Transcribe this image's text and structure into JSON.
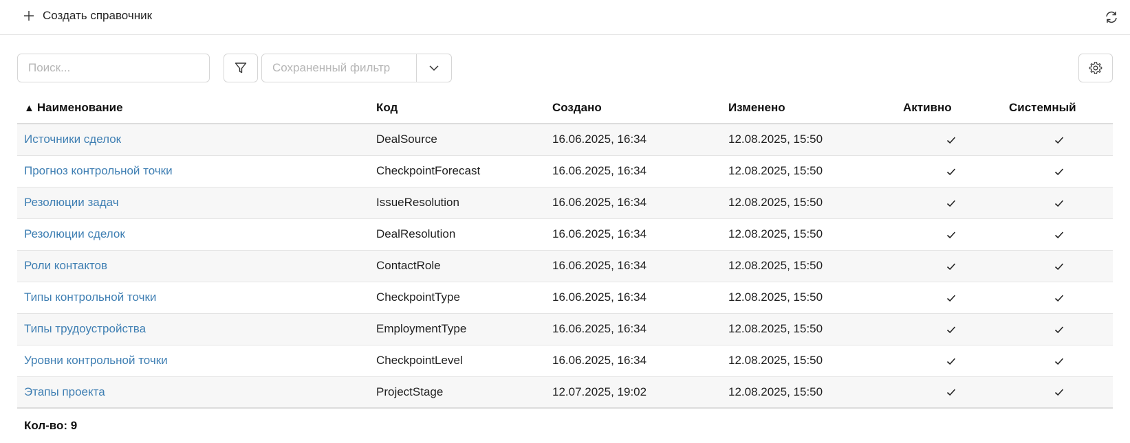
{
  "topbar": {
    "create_label": "Создать справочник"
  },
  "toolbar": {
    "search_placeholder": "Поиск...",
    "saved_filter_placeholder": "Сохраненный фильтр"
  },
  "table": {
    "sort_indicator": "▲",
    "columns": {
      "name": "Наименование",
      "code": "Код",
      "created": "Создано",
      "changed": "Изменено",
      "active": "Активно",
      "system": "Системный"
    },
    "rows": [
      {
        "name": "Источники сделок",
        "code": "DealSource",
        "created": "16.06.2025, 16:34",
        "changed": "12.08.2025, 15:50",
        "active": true,
        "system": true
      },
      {
        "name": "Прогноз контрольной точки",
        "code": "CheckpointForecast",
        "created": "16.06.2025, 16:34",
        "changed": "12.08.2025, 15:50",
        "active": true,
        "system": true
      },
      {
        "name": "Резолюции задач",
        "code": "IssueResolution",
        "created": "16.06.2025, 16:34",
        "changed": "12.08.2025, 15:50",
        "active": true,
        "system": true
      },
      {
        "name": "Резолюции сделок",
        "code": "DealResolution",
        "created": "16.06.2025, 16:34",
        "changed": "12.08.2025, 15:50",
        "active": true,
        "system": true
      },
      {
        "name": "Роли контактов",
        "code": "ContactRole",
        "created": "16.06.2025, 16:34",
        "changed": "12.08.2025, 15:50",
        "active": true,
        "system": true
      },
      {
        "name": "Типы контрольной точки",
        "code": "CheckpointType",
        "created": "16.06.2025, 16:34",
        "changed": "12.08.2025, 15:50",
        "active": true,
        "system": true
      },
      {
        "name": "Типы трудоустройства",
        "code": "EmploymentType",
        "created": "16.06.2025, 16:34",
        "changed": "12.08.2025, 15:50",
        "active": true,
        "system": true
      },
      {
        "name": "Уровни контрольной точки",
        "code": "CheckpointLevel",
        "created": "16.06.2025, 16:34",
        "changed": "12.08.2025, 15:50",
        "active": true,
        "system": true
      },
      {
        "name": "Этапы проекта",
        "code": "ProjectStage",
        "created": "12.07.2025, 19:02",
        "changed": "12.08.2025, 15:50",
        "active": true,
        "system": true
      }
    ]
  },
  "footer": {
    "count_label": "Кол-во: 9"
  },
  "icons": {
    "create": "plus-icon",
    "refresh": "refresh-icon",
    "filter": "funnel-icon",
    "dropdown": "chevron-down-icon",
    "settings": "gear-icon",
    "check": "check-icon"
  },
  "colors": {
    "link": "#3f7fb3",
    "row_stripe": "#f7f7f7",
    "border": "#d6d6d6"
  }
}
